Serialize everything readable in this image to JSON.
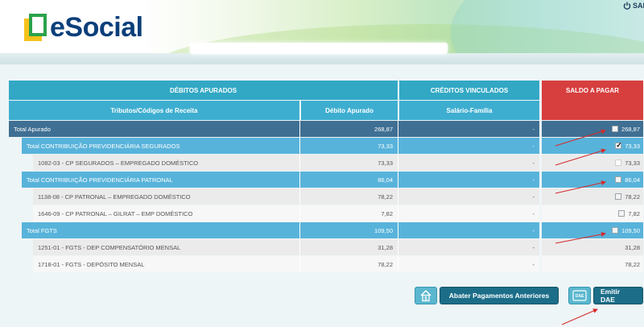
{
  "header": {
    "logo_text": "eSocial",
    "logout_label": "SAI"
  },
  "table": {
    "group_headers": {
      "debitos": "DÉBITOS APURADOS",
      "creditos": "CRÉDITOS VINCULADOS",
      "saldo": "SALDO A PAGAR"
    },
    "sub_headers": {
      "tributos": "Tributos/Códigos de Receita",
      "debito_apurado": "Débito Apurado",
      "salario_familia": "Salário-Família"
    },
    "rows": [
      {
        "label": "Total Apurado",
        "debito": "268,87",
        "credito": "-",
        "saldo": "268,87",
        "checkbox": "unchecked"
      },
      {
        "label": "Total CONTRIBUIÇÃO PREVIDENCIÁRIA SEGURADOS",
        "debito": "73,33",
        "credito": "-",
        "saldo": "73,33",
        "checkbox": "checked"
      },
      {
        "label": "1082-03 - CP SEGURADOS – EMPREGADO DOMÉSTICO",
        "debito": "73,33",
        "credito": "-",
        "saldo": "73,33",
        "checkbox": "disabled"
      },
      {
        "label": "Total CONTRIBUIÇÃO PREVIDENCIÁRIA PATRONAL",
        "debito": "86,04",
        "credito": "-",
        "saldo": "86,04",
        "checkbox": "unchecked"
      },
      {
        "label": "1138-08 - CP PATRONAL – EMPREGADO DOMÉSTICO",
        "debito": "78,22",
        "credito": "-",
        "saldo": "78,22",
        "checkbox": "unchecked"
      },
      {
        "label": "1646-09 - CP PATRONAL – GILRAT – EMP DOMÉSTICO",
        "debito": "7,82",
        "credito": "-",
        "saldo": "7,82",
        "checkbox": "unchecked"
      },
      {
        "label": "Total FGTS",
        "debito": "109,50",
        "credito": "-",
        "saldo": "109,50",
        "checkbox": "unchecked"
      },
      {
        "label": "1251-01 - FGTS - DEP COMPENSATÓRIO MENSAL",
        "debito": "31,28",
        "credito": "-",
        "saldo": "31,28",
        "checkbox": "none"
      },
      {
        "label": "1718-01 - FGTS - DEPÓSITO MENSAL",
        "debito": "78,22",
        "credito": "-",
        "saldo": "78,22",
        "checkbox": "none"
      }
    ]
  },
  "actions": {
    "abater_label": "Abater Pagamentos Anteriores",
    "emitir_label": "Emitir DAE",
    "dae_icon_text": "DAE"
  },
  "colors": {
    "total_row": "#3f6f93",
    "subtotal_row": "#58b3da",
    "header_blue": "#32a8c4",
    "saldo_header": "#d63f3e",
    "button": "#1c6e88",
    "annotation_arrow": "#d42a2a"
  }
}
